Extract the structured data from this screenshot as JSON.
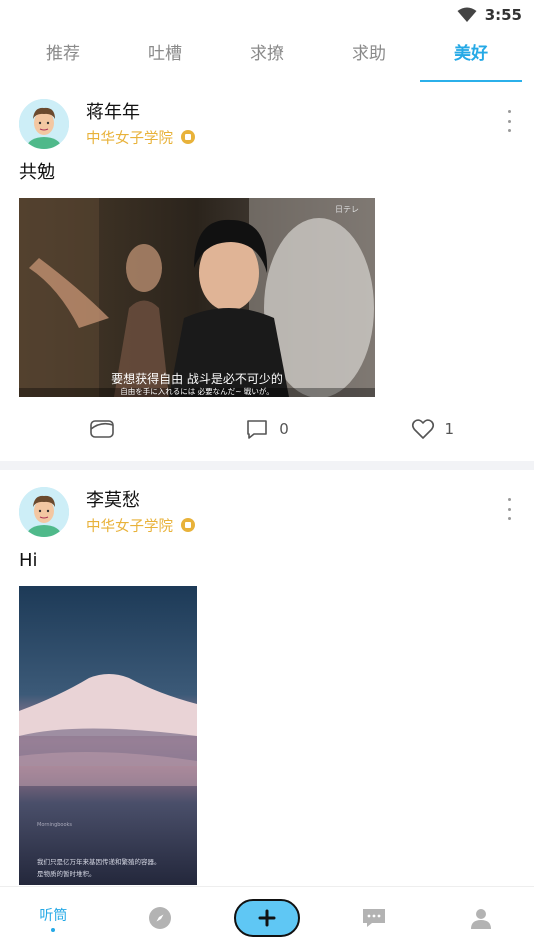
{
  "status_bar": {
    "time": "3:55"
  },
  "tabs": [
    {
      "label": "推荐",
      "active": false
    },
    {
      "label": "吐槽",
      "active": false
    },
    {
      "label": "求撩",
      "active": false
    },
    {
      "label": "求助",
      "active": false
    },
    {
      "label": "美好",
      "active": true
    }
  ],
  "posts": [
    {
      "username": "蒋年年",
      "school": "中华女子学院",
      "text": "共勉",
      "image": {
        "subtitle_cn": "要想获得自由 战斗是必不可少的",
        "subtitle_jp": "自由を手に入れるには 必要なんだ~ 戦いが。",
        "watermark": "日テレ"
      },
      "comments": "0",
      "likes": "1"
    },
    {
      "username": "李莫愁",
      "school": "中华女子学院",
      "text": "Hi",
      "image": {
        "caption_small": "Morningbooks",
        "caption_line1": "我们只是亿万年来基因传递和繁殖的容器。",
        "caption_line2": "是物质的暂时堆积。"
      }
    }
  ],
  "bottom_nav": {
    "home_label": "听筒",
    "icons": [
      "compass-icon",
      "plus-icon",
      "chat-icon",
      "person-icon"
    ]
  },
  "colors": {
    "accent": "#25a9e6",
    "school": "#e8b23a",
    "add_button": "#5fc7f4"
  }
}
